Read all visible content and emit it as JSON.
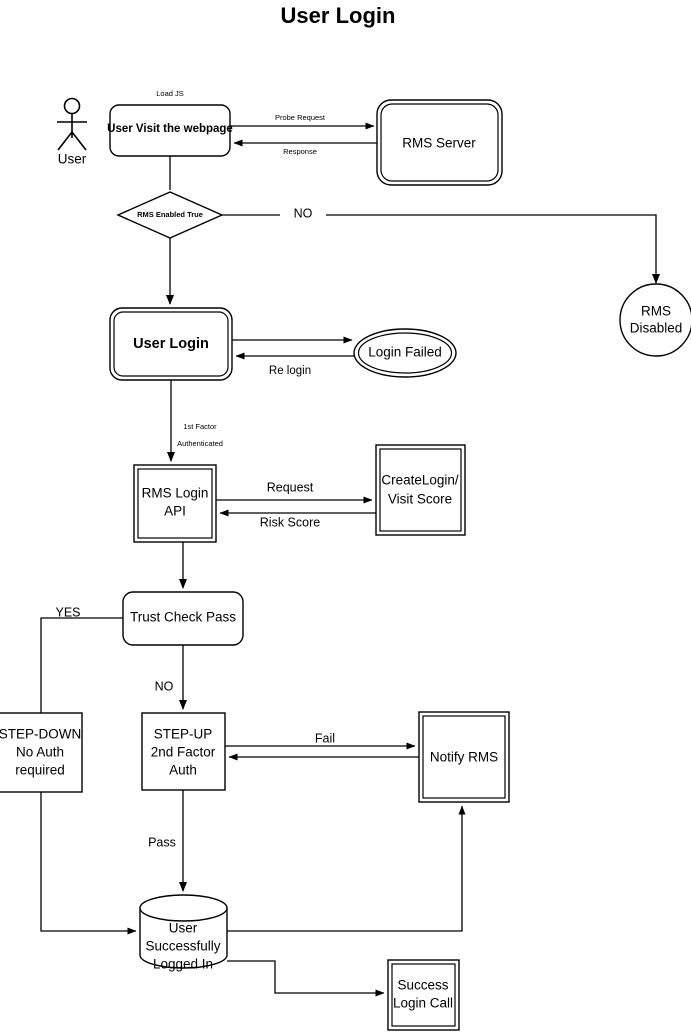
{
  "title": "User Login",
  "nodes": {
    "actor": {
      "label": "User",
      "icon": "actor-stick-figure-icon"
    },
    "visit_webpage": {
      "label": "User Visit the webpage"
    },
    "rms_server": {
      "label": "RMS Server"
    },
    "rms_enabled": {
      "label": "RMS Enabled True"
    },
    "rms_disabled": {
      "label_line1": "RMS",
      "label_line2": "Disabled"
    },
    "user_login": {
      "label": "User Login"
    },
    "login_failed": {
      "label": "Login Failed"
    },
    "rms_login_api": {
      "label_line1": "RMS Login",
      "label_line2": "API"
    },
    "create_login": {
      "label_line1": "CreateLogin/",
      "label_line2": "Visit Score"
    },
    "trust_check": {
      "label": "Trust Check Pass"
    },
    "step_down": {
      "label_line1": "STEP-DOWN",
      "label_line2": "No Auth",
      "label_line3": "required"
    },
    "step_up": {
      "label_line1": "STEP-UP",
      "label_line2": "2nd Factor",
      "label_line3": "Auth"
    },
    "notify_rms": {
      "label": "Notify RMS"
    },
    "logged_in": {
      "label_line1": "User",
      "label_line2": "Successfully",
      "label_line3": "Logged In"
    },
    "success_call": {
      "label_line1": "Success",
      "label_line2": "Login Call"
    }
  },
  "edge_labels": {
    "load_js": "Load JS",
    "probe_request": "Probe Request",
    "response": "Response",
    "no_rms": "NO",
    "re_login": "Re login",
    "first_factor": "1st Factor",
    "authenticated": "Authenticated",
    "request": "Request",
    "risk_score": "Risk Score",
    "yes": "YES",
    "no_trust": "NO",
    "fail": "Fail",
    "pass": "Pass"
  },
  "colors": {
    "stroke": "#000000",
    "fill": "#ffffff",
    "text": "#000000"
  }
}
